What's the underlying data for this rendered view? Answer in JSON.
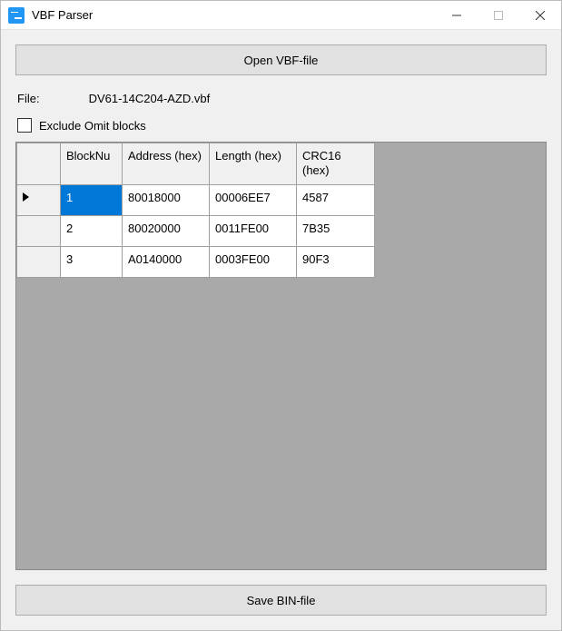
{
  "window": {
    "title": "VBF Parser"
  },
  "buttons": {
    "open": "Open VBF-file",
    "save": "Save BIN-file"
  },
  "file": {
    "label": "File:",
    "value": "DV61-14C204-AZD.vbf"
  },
  "exclude": {
    "label": "Exclude Omit blocks",
    "checked": false
  },
  "grid": {
    "headers": {
      "rowheader": "",
      "blocknum": "BlockNu",
      "address": "Address (hex)",
      "length": "Length (hex)",
      "crc16": "CRC16 (hex)"
    },
    "rows": [
      {
        "blocknum": "1",
        "address": "80018000",
        "length": "00006EE7",
        "crc16": "4587",
        "selected": true,
        "current": true
      },
      {
        "blocknum": "2",
        "address": "80020000",
        "length": "0011FE00",
        "crc16": "7B35",
        "selected": false,
        "current": false
      },
      {
        "blocknum": "3",
        "address": "A0140000",
        "length": "0003FE00",
        "crc16": "90F3",
        "selected": false,
        "current": false
      }
    ]
  }
}
